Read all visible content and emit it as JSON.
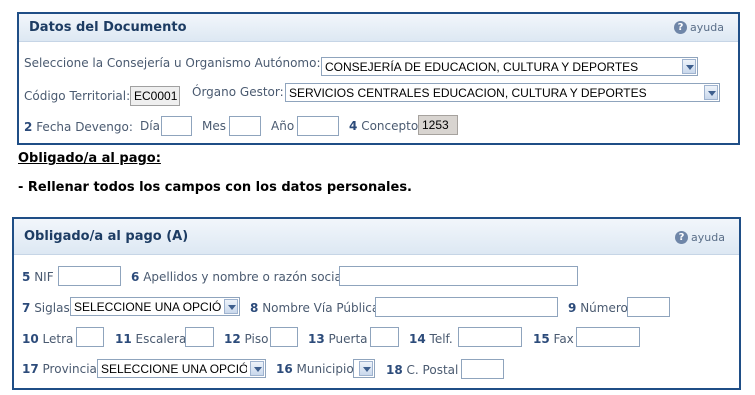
{
  "doc_panel": {
    "title": "Datos del Documento",
    "help_label": "ayuda",
    "consejeria_label": "Seleccione la Consejería u Organismo Autónomo:",
    "consejeria_value": "CONSEJERÍA DE EDUCACION, CULTURA Y DEPORTES",
    "codigo_label": "Código Territorial:",
    "codigo_value": "EC0001",
    "organo_label": "Órgano Gestor:",
    "organo_value": "SERVICIOS CENTRALES EDUCACION, CULTURA Y DEPORTES",
    "fecha_num": "2",
    "fecha_label": "Fecha Devengo:",
    "dia_label": "Día",
    "mes_label": "Mes",
    "anio_label": "Año",
    "concepto_num": "4",
    "concepto_label": "Concepto",
    "concepto_value": "1253"
  },
  "obligado_heading": "Obligado/a al pago:",
  "instruction": "-  Rellenar todos los campos con los datos personales.",
  "payer_panel": {
    "title": "Obligado/a al pago (A)",
    "help_label": "ayuda",
    "fields": {
      "nif": {
        "num": "5",
        "label": "NIF"
      },
      "apellidos": {
        "num": "6",
        "label": "Apellidos y nombre o razón social"
      },
      "siglas": {
        "num": "7",
        "label": "Siglas",
        "value": "SELECCIONE UNA OPCIÓN"
      },
      "via": {
        "num": "8",
        "label": "Nombre Vía Pública"
      },
      "numero": {
        "num": "9",
        "label": "Número"
      },
      "letra": {
        "num": "10",
        "label": "Letra"
      },
      "escalera": {
        "num": "11",
        "label": "Escalera"
      },
      "piso": {
        "num": "12",
        "label": "Piso"
      },
      "puerta": {
        "num": "13",
        "label": "Puerta"
      },
      "telf": {
        "num": "14",
        "label": "Telf."
      },
      "fax": {
        "num": "15",
        "label": "Fax"
      },
      "provincia": {
        "num": "17",
        "label": "Provincia",
        "value": "SELECCIONE UNA OPCIÓN"
      },
      "municipio": {
        "num": "16",
        "label": "Municipio",
        "value": ""
      },
      "postal": {
        "num": "18",
        "label": "C. Postal"
      }
    }
  }
}
